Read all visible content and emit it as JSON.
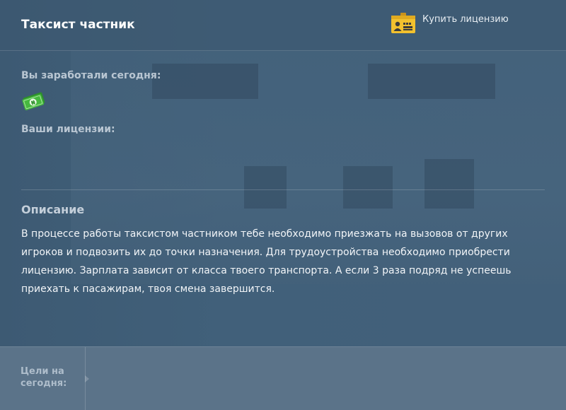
{
  "header": {
    "title": "Таксист частник",
    "buy_license_label": "Купить лицензию",
    "buy_license_icon": "license-card-icon"
  },
  "main": {
    "earned_today_label": "Вы заработали сегодня:",
    "money_icon": "money-icon",
    "licenses_label": "Ваши лицензии:",
    "description_title": "Описание",
    "description_text": "В процессе работы таксистом частником тебе необходимо приезжать на вызовов от других игроков и подвозить их до точки назначения. Для трудоустройства необходимо приобрести лицензию. Зарплата зависит от класса твоего транспорта. А если 3 раза подряд не успеешь приехать к пасажирам, твоя смена завершится."
  },
  "footer": {
    "goals_label": "Цели на сегодня:"
  },
  "colors": {
    "background": "#3f5a72",
    "footer": "#5b7389",
    "license_icon": "#f2c12e",
    "money_icon": "#3fae3a"
  }
}
